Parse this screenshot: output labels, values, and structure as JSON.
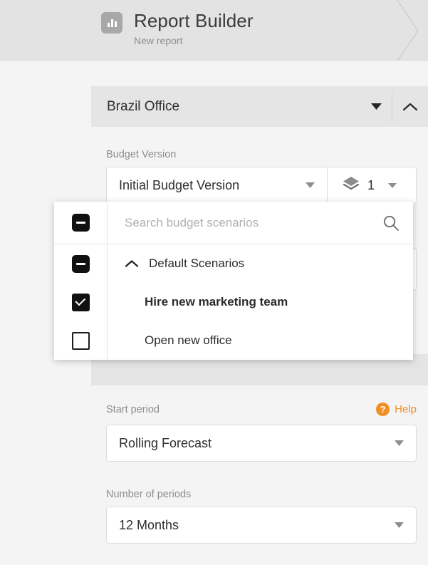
{
  "header": {
    "icon": "bar-chart-icon",
    "title": "Report Builder",
    "subtitle": "New report"
  },
  "entity_selector": {
    "label": "Brazil Office",
    "caret_icon": "caret-down-icon",
    "collapse_icon": "chevron-up-icon"
  },
  "budget_version": {
    "label": "Budget Version",
    "value": "Initial Budget Version",
    "caret_icon": "caret-down-icon",
    "layers_icon": "layers-icon",
    "layers_count": "1",
    "layers_caret_icon": "caret-down-icon"
  },
  "scenario_dropdown": {
    "search": {
      "placeholder": "Search budget scenarios",
      "value": "",
      "icon": "search-icon",
      "checkbox_state": "indeterminate"
    },
    "group": {
      "label": "Default Scenarios",
      "caret_icon": "chevron-up-icon",
      "checkbox_state": "indeterminate"
    },
    "options": [
      {
        "label": "Hire new marketing team",
        "checkbox_state": "checked",
        "selected": true
      },
      {
        "label": "Open new office",
        "checkbox_state": "unchecked",
        "selected": false
      }
    ]
  },
  "start_period": {
    "label": "Start period",
    "value": "Rolling Forecast",
    "caret_icon": "caret-down-icon",
    "help": {
      "label": "Help",
      "icon": "question-mark-icon",
      "color": "#ef8f20"
    }
  },
  "number_of_periods": {
    "label": "Number of periods",
    "value": "12 Months",
    "caret_icon": "caret-down-icon"
  }
}
